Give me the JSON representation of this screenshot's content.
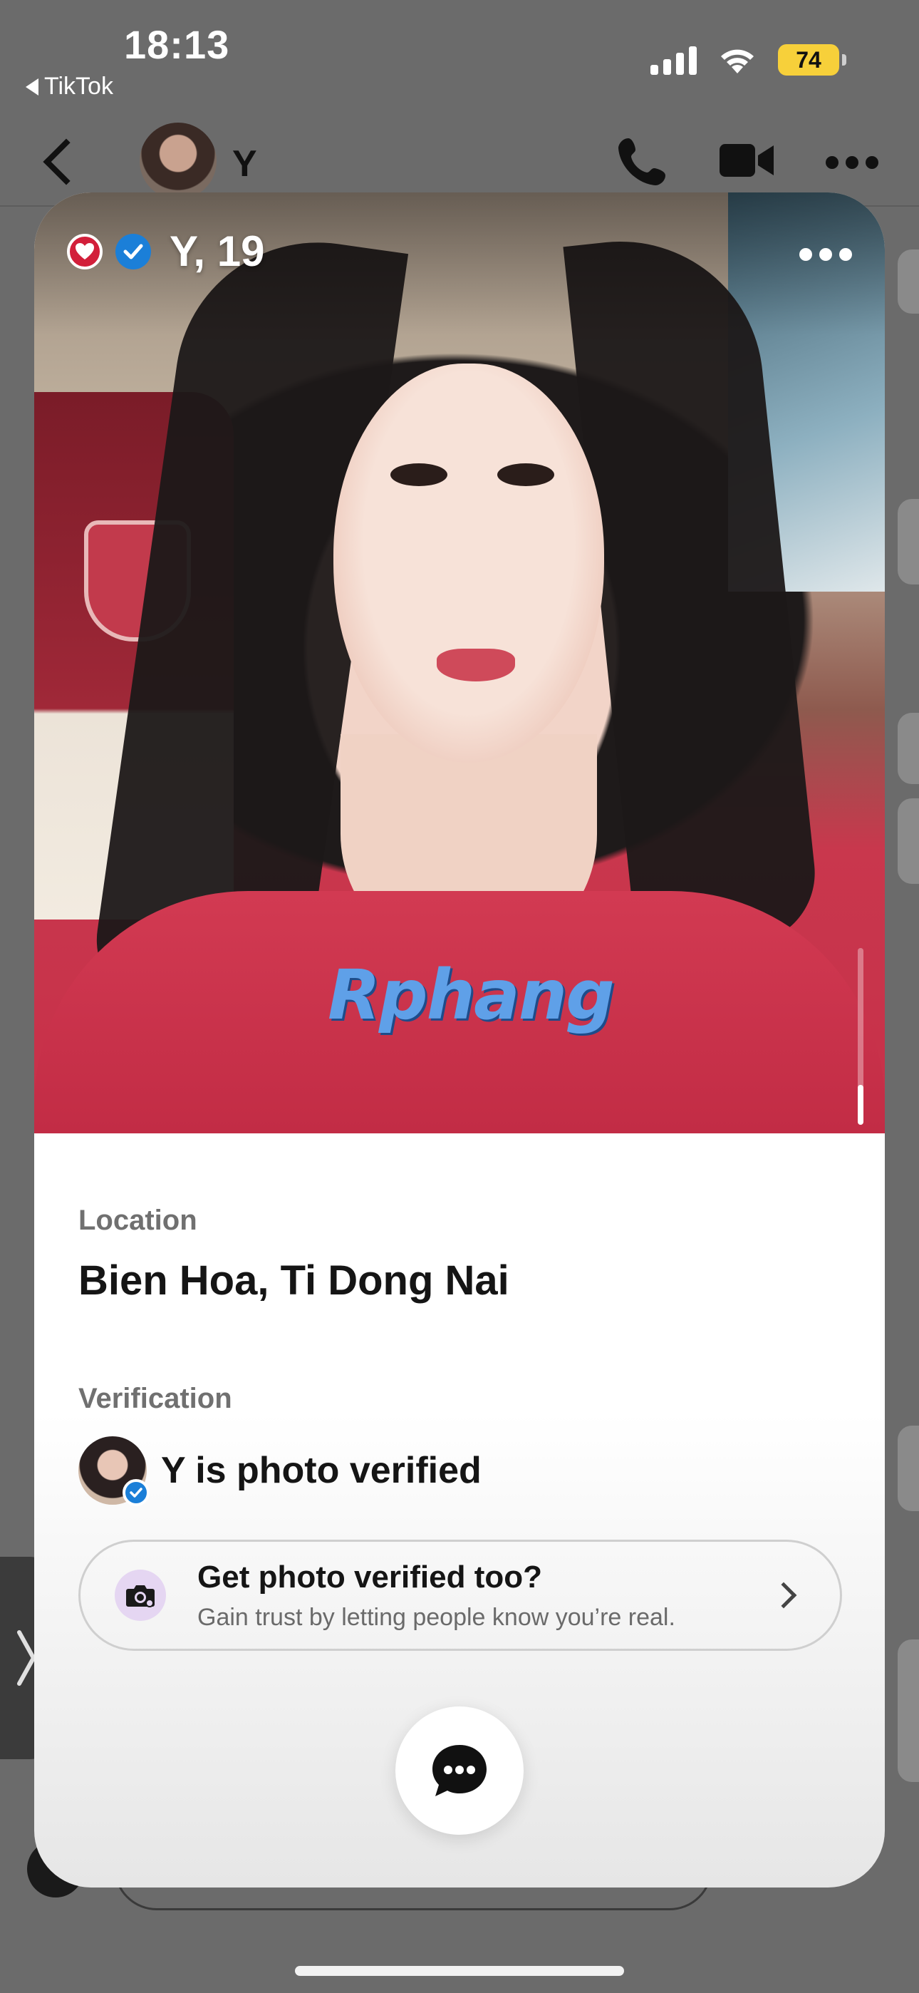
{
  "status_bar": {
    "time": "18:13",
    "back_app": "TikTok",
    "battery": "74",
    "signal_icon": "signal-icon",
    "wifi_icon": "wifi-icon"
  },
  "chat_header": {
    "name": "Y",
    "back_icon": "chevron-left-icon",
    "call_icon": "phone-icon",
    "video_icon": "video-camera-icon",
    "more_icon": "more-horizontal-icon"
  },
  "profile": {
    "name_age": "Y, 19",
    "watermark": "Rphang",
    "location_label": "Location",
    "location_value": "Bien Hoa, Ti Dong Nai",
    "verification_label": "Verification",
    "verified_text": "Y is photo verified"
  },
  "cta": {
    "title": "Get photo verified too?",
    "subtitle": "Gain trust by letting people know you’re real."
  },
  "colors": {
    "verify_blue": "#1b7fd8",
    "match_red": "#d21f3a",
    "battery_yellow": "#f7d03a",
    "cta_icon_bg": "#e5d6f2"
  }
}
